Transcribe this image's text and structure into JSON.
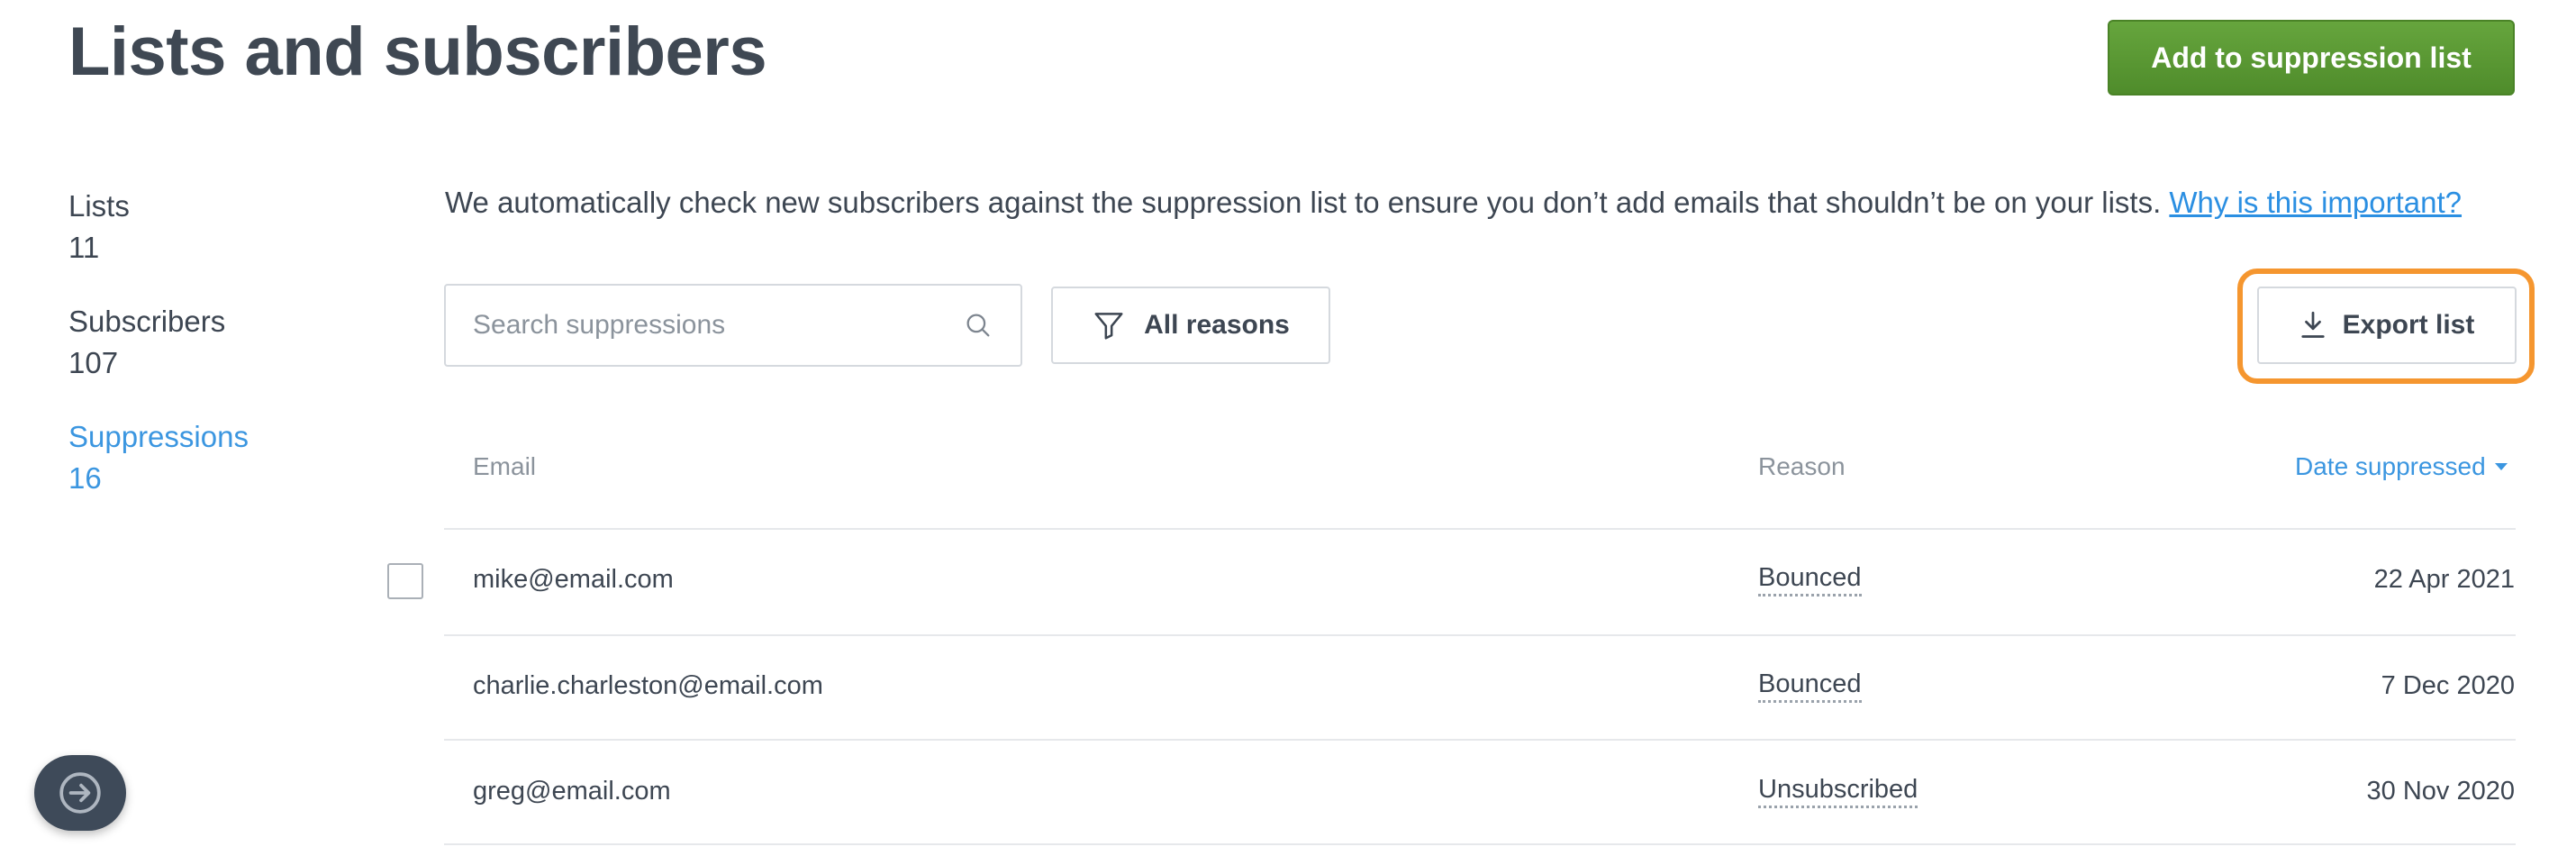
{
  "page": {
    "title": "Lists and subscribers",
    "primary_action": "Add to suppression list"
  },
  "colors": {
    "primary_green": "#5a9c33",
    "link_blue": "#2b8fe2",
    "highlight_orange": "#f5962f"
  },
  "sidebar": {
    "items": [
      {
        "label": "Lists",
        "count": "11",
        "active": false
      },
      {
        "label": "Subscribers",
        "count": "107",
        "active": false
      },
      {
        "label": "Suppressions",
        "count": "16",
        "active": true
      }
    ]
  },
  "intro": {
    "text": "We automatically check new subscribers against the suppression list to ensure you don’t add emails that shouldn’t be on your lists. ",
    "link": "Why is this important?"
  },
  "toolbar": {
    "search_placeholder": "Search suppressions",
    "search_icon": "search-icon",
    "filter_label": "All reasons",
    "filter_icon": "filter-icon",
    "export_label": "Export list",
    "export_icon": "download-icon"
  },
  "table": {
    "columns": [
      "Email",
      "Reason",
      "Date suppressed"
    ],
    "sort_column": "Date suppressed",
    "rows": [
      {
        "email": "mike@email.com",
        "reason": "Bounced",
        "date": "22 Apr 2021"
      },
      {
        "email": "charlie.charleston@email.com",
        "reason": "Bounced",
        "date": "7 Dec 2020"
      },
      {
        "email": "greg@email.com",
        "reason": "Unsubscribed",
        "date": "30 Nov 2020"
      }
    ]
  },
  "floating_button": {
    "icon": "arrow-right-circle-icon"
  }
}
